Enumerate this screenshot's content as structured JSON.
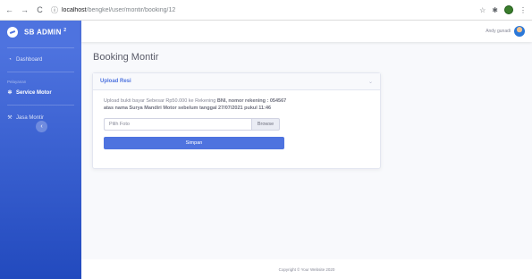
{
  "browser": {
    "url_host": "localhost",
    "url_path": "/bengkel/user/montir/booking/12",
    "star_icon": "star-icon",
    "ext_icon": "puzzle-icon"
  },
  "sidebar": {
    "brand": "SB ADMIN",
    "brand_sup": "2",
    "items": [
      {
        "label": "Dashboard",
        "icon": "tachometer-icon"
      },
      {
        "label": "Service Motor",
        "icon": "cog-icon"
      },
      {
        "label": "Jasa Montir",
        "icon": "wrench-icon"
      }
    ],
    "heading": "Pelayanan",
    "toggle": "‹"
  },
  "topbar": {
    "username": "Andy gunadi"
  },
  "main": {
    "page_title": "Booking Montir",
    "card_title": "Upload Resi",
    "note_prefix": "Upload bukti bayar Sebesar Rp50.000 ke Rekening ",
    "note_bank": "BNI, nomor rekening : 054567 atas nama Surya Mandiri Motor sebelum tanggal 27/07/2021 pukul 11:46",
    "file_placeholder": "Pilih Foto",
    "browse_label": "Browse",
    "submit_label": "Simpan"
  },
  "footer": {
    "text": "Copyright © Your Website 2020"
  },
  "colors": {
    "primary": "#4e73df",
    "sidebar_dark": "#224abe"
  }
}
